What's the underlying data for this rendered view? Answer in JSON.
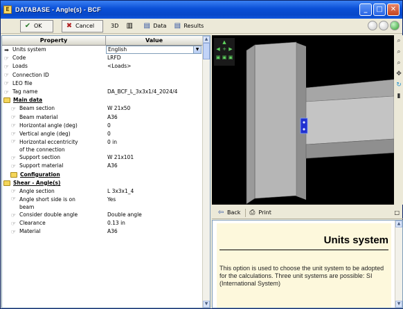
{
  "window": {
    "title": "DATABASE - Angle(s) - BCF"
  },
  "toolbar": {
    "ok_label": "OK",
    "cancel_label": "Cancel",
    "view3d_label": "3D",
    "data_label": "Data",
    "results_label": "Results"
  },
  "grid": {
    "col_property": "Property",
    "col_value": "Value",
    "rows": [
      {
        "p": "Units system",
        "v": "English"
      },
      {
        "p": "Code",
        "v": "LRFD"
      },
      {
        "p": "Loads",
        "v": "<Loads>"
      },
      {
        "p": "Connection ID",
        "v": ""
      },
      {
        "p": "LEO file",
        "v": ""
      },
      {
        "p": "Tag name",
        "v": "DA_BCF_L_3x3x1/4_2024/4"
      },
      {
        "p": "Main data",
        "v": ""
      },
      {
        "p": "Beam section",
        "v": "W 21x50"
      },
      {
        "p": "Beam material",
        "v": "A36"
      },
      {
        "p": "Horizontal angle (deg)",
        "v": "0"
      },
      {
        "p": "Vertical angle (deg)",
        "v": "0"
      },
      {
        "p": "Horizontal eccentricity",
        "p2": "of the connection",
        "v": "0 in"
      },
      {
        "p": "Support section",
        "v": "W 21x101"
      },
      {
        "p": "Support material",
        "v": "A36"
      },
      {
        "p": "Configuration",
        "v": ""
      },
      {
        "p": "Shear - Angle(s)",
        "v": ""
      },
      {
        "p": "Angle section",
        "v": "L 3x3x1_4"
      },
      {
        "p": "Angle short side is on",
        "p2": "beam",
        "v": "Yes"
      },
      {
        "p": "Consider double angle",
        "v": "Double angle"
      },
      {
        "p": "Clearance",
        "v": "0.13 in"
      },
      {
        "p": "Material",
        "v": "A36"
      }
    ]
  },
  "help": {
    "back_label": "Back",
    "print_label": "Print",
    "title": "Units system",
    "text": "This option is used to choose the unit system to be adopted for the calculations. Three unit systems are possible: SI (International System)"
  },
  "colors": {
    "titlebar": "#0848c8",
    "member": "#b4b4b4",
    "bolt_plate": "#2030d0",
    "background_3d": "#000000"
  }
}
